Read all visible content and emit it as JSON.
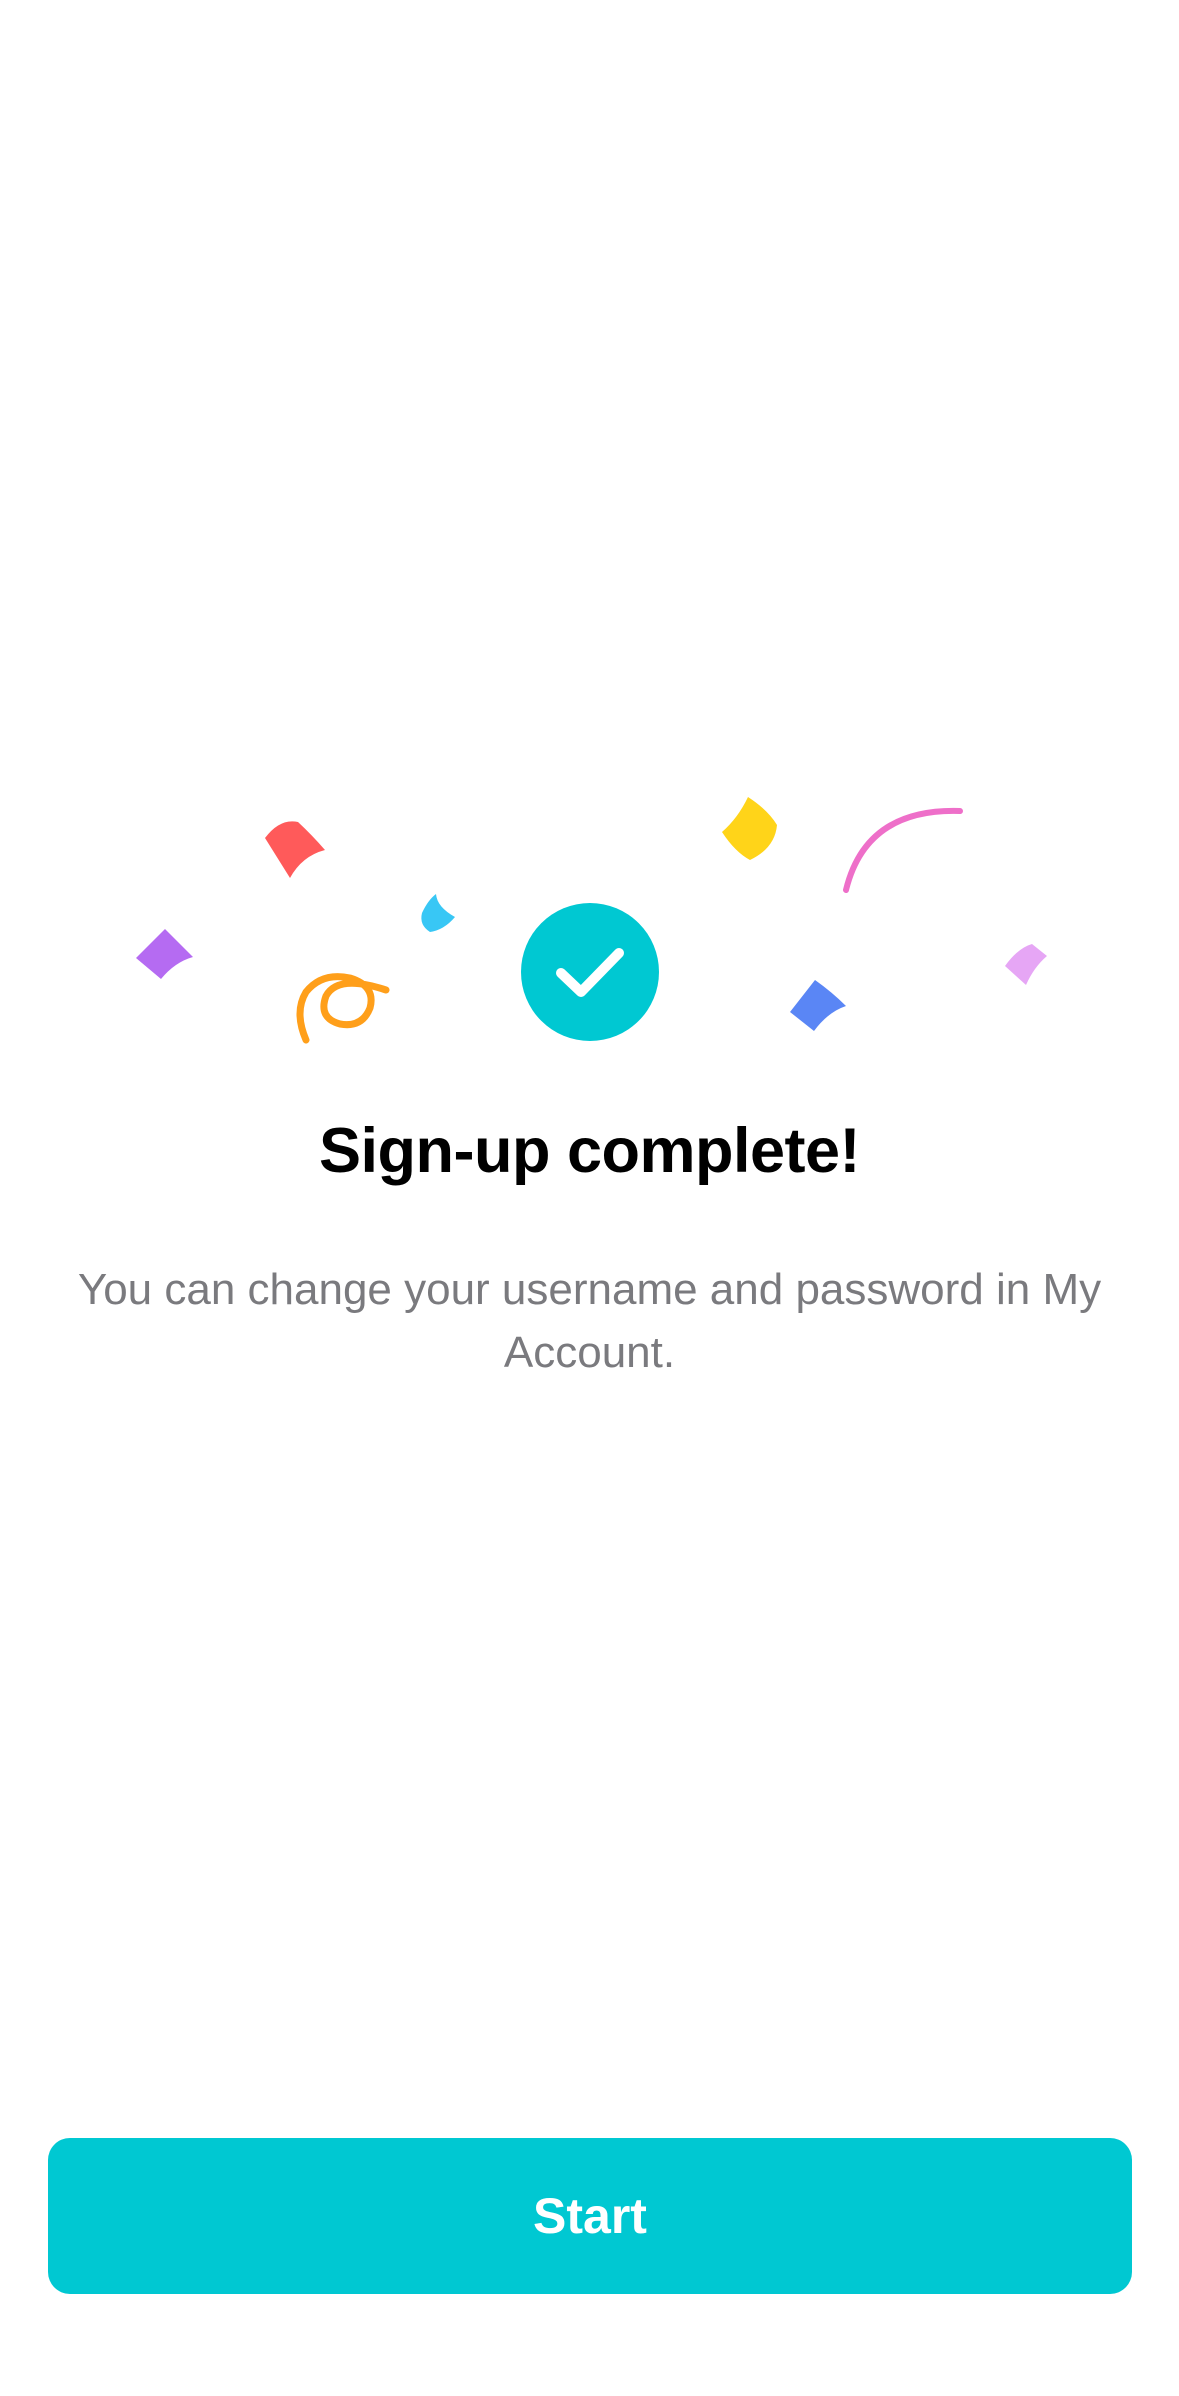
{
  "colors": {
    "accent": "#00C8D2",
    "title": "#000000",
    "subtitle": "#7A7A7E",
    "confetti_red": "#FF5A5A",
    "confetti_purple": "#B56BF2",
    "confetti_cyan": "#38C7F5",
    "confetti_orange": "#FF9F1A",
    "confetti_yellow": "#FFD419",
    "confetti_pink": "#EE6FC9",
    "confetti_blue": "#5A86F5",
    "confetti_lilac": "#E6A6F5"
  },
  "hero": {
    "icon": "check-circle-icon",
    "decoration": "confetti"
  },
  "content": {
    "title": "Sign-up complete!",
    "subtitle": "You can change your username and password in My Account."
  },
  "actions": {
    "start_label": "Start"
  }
}
